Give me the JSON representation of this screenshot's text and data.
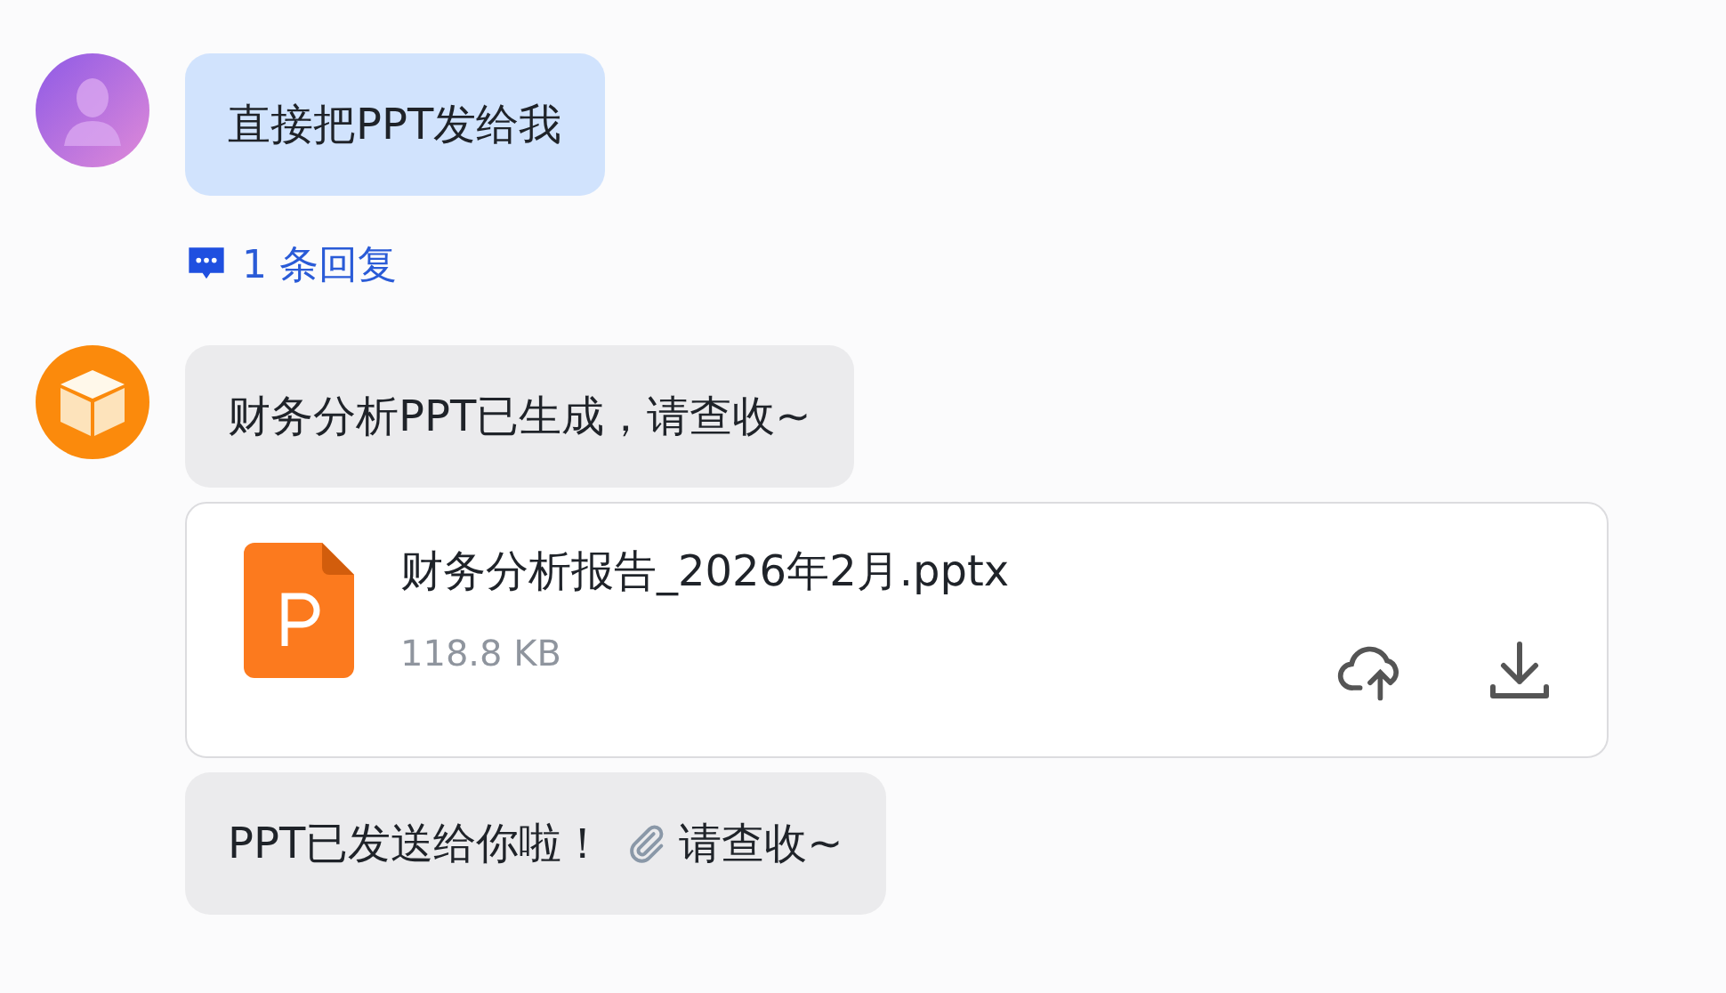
{
  "groups": [
    {
      "kind": "user",
      "items": [
        {
          "kind": "text",
          "text": "直接把PPT发给我"
        }
      ],
      "replies": "1 条回复"
    },
    {
      "kind": "bot",
      "items": [
        {
          "kind": "text",
          "text": "财务分析PPT已生成，请查收~"
        },
        {
          "kind": "file",
          "file_name": "财务分析报告_2026年2月.pptx",
          "size": "118.8 KB"
        },
        {
          "kind": "clip_text",
          "text_before": "PPT已发送给你啦！",
          "text_after": "请查收~"
        }
      ]
    }
  ]
}
